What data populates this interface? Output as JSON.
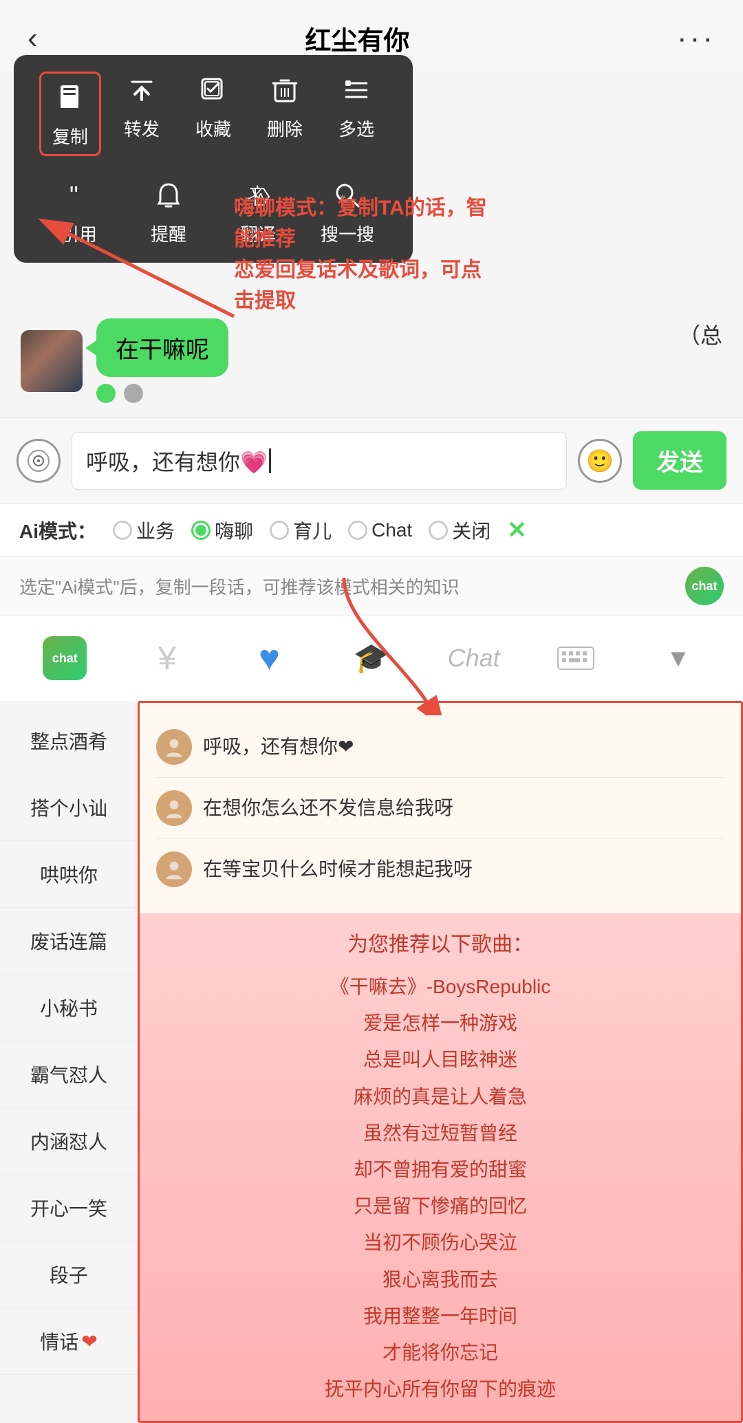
{
  "header": {
    "back_label": "‹",
    "title": "红尘有你",
    "more_label": "···"
  },
  "context_menu": {
    "row1": [
      {
        "id": "copy",
        "icon": "📄",
        "label": "复制",
        "highlighted": true
      },
      {
        "id": "forward",
        "icon": "↪",
        "label": "转发"
      },
      {
        "id": "collect",
        "icon": "◈",
        "label": "收藏"
      },
      {
        "id": "delete",
        "icon": "🗑",
        "label": "删除"
      },
      {
        "id": "multiselect",
        "icon": "☰",
        "label": "多选"
      }
    ],
    "row2": [
      {
        "id": "quote",
        "icon": "❝",
        "label": "引用"
      },
      {
        "id": "remind",
        "icon": "🔔",
        "label": "提醒"
      },
      {
        "id": "translate",
        "icon": "✎",
        "label": "翻译"
      },
      {
        "id": "search",
        "icon": "✳",
        "label": "搜一搜"
      }
    ]
  },
  "annotation": {
    "text": "嗨聊模式：复制TA的话，智能推荐\n恋爱回复话术及歌词，可点击提取"
  },
  "chat": {
    "bubble_text": "在干嘛呢",
    "title_suffix": "（总"
  },
  "input_bar": {
    "text": "呼吸，还有想你💗",
    "send_label": "发送",
    "heart_emoji": "💗"
  },
  "ai_mode": {
    "label": "Ai模式：",
    "options": [
      {
        "id": "business",
        "label": "业务",
        "active": false
      },
      {
        "id": "haichat",
        "label": "嗨聊",
        "active": true
      },
      {
        "id": "parenting",
        "label": "育儿",
        "active": false
      },
      {
        "id": "chat",
        "label": "Chat",
        "active": false
      },
      {
        "id": "close",
        "label": "关闭",
        "active": false
      }
    ],
    "close_icon": "✕"
  },
  "hint_bar": {
    "text": "选定\"Ai模式\"后，复制一段话，可推荐该模式相关的知识"
  },
  "toolbar": {
    "items": [
      {
        "id": "ai-chat",
        "label": "chat"
      },
      {
        "id": "yen",
        "label": "¥"
      },
      {
        "id": "heart",
        "label": "♥"
      },
      {
        "id": "graduation",
        "label": "🎓"
      },
      {
        "id": "chat-text",
        "label": "Chat"
      },
      {
        "id": "keyboard",
        "label": "⌨"
      },
      {
        "id": "down-arrow",
        "label": "▼"
      }
    ]
  },
  "sidebar": {
    "items": [
      {
        "id": "zhengdian",
        "label": "整点酒肴"
      },
      {
        "id": "sougexiaoshan",
        "label": "搭个小讪"
      },
      {
        "id": "houhouni",
        "label": "哄哄你"
      },
      {
        "id": "feihuazo",
        "label": "废话连篇"
      },
      {
        "id": "xiaomishu",
        "label": "小秘书"
      },
      {
        "id": "baqiruren",
        "label": "霸气怼人"
      },
      {
        "id": "neihanruren",
        "label": "内涵怼人"
      },
      {
        "id": "kaiyixiao",
        "label": "开心一笑"
      },
      {
        "id": "duanzi",
        "label": "段子"
      },
      {
        "id": "qinghua",
        "label": "情话",
        "heart": true
      }
    ]
  },
  "suggestions": [
    {
      "id": "s1",
      "text": "呼吸，还有想你❤"
    },
    {
      "id": "s2",
      "text": "在想你怎么还不发信息给我呀"
    },
    {
      "id": "s3",
      "text": "在等宝贝什么时候才能想起我呀"
    }
  ],
  "songs_section": {
    "title": "为您推荐以下歌曲：",
    "song_title": "《干嘛去》-BoysRepublic",
    "lyrics": [
      "爱是怎样一种游戏",
      "总是叫人目眩神迷",
      "麻烦的真是让人着急",
      "虽然有过短暂曾经",
      "却不曾拥有爱的甜蜜",
      "只是留下惨痛的回忆",
      "当初不顾伤心哭泣",
      "狠心离我而去",
      "我用整整一年时间",
      "才能将你忘记",
      "抚平内心所有你留下的痕迹"
    ]
  }
}
